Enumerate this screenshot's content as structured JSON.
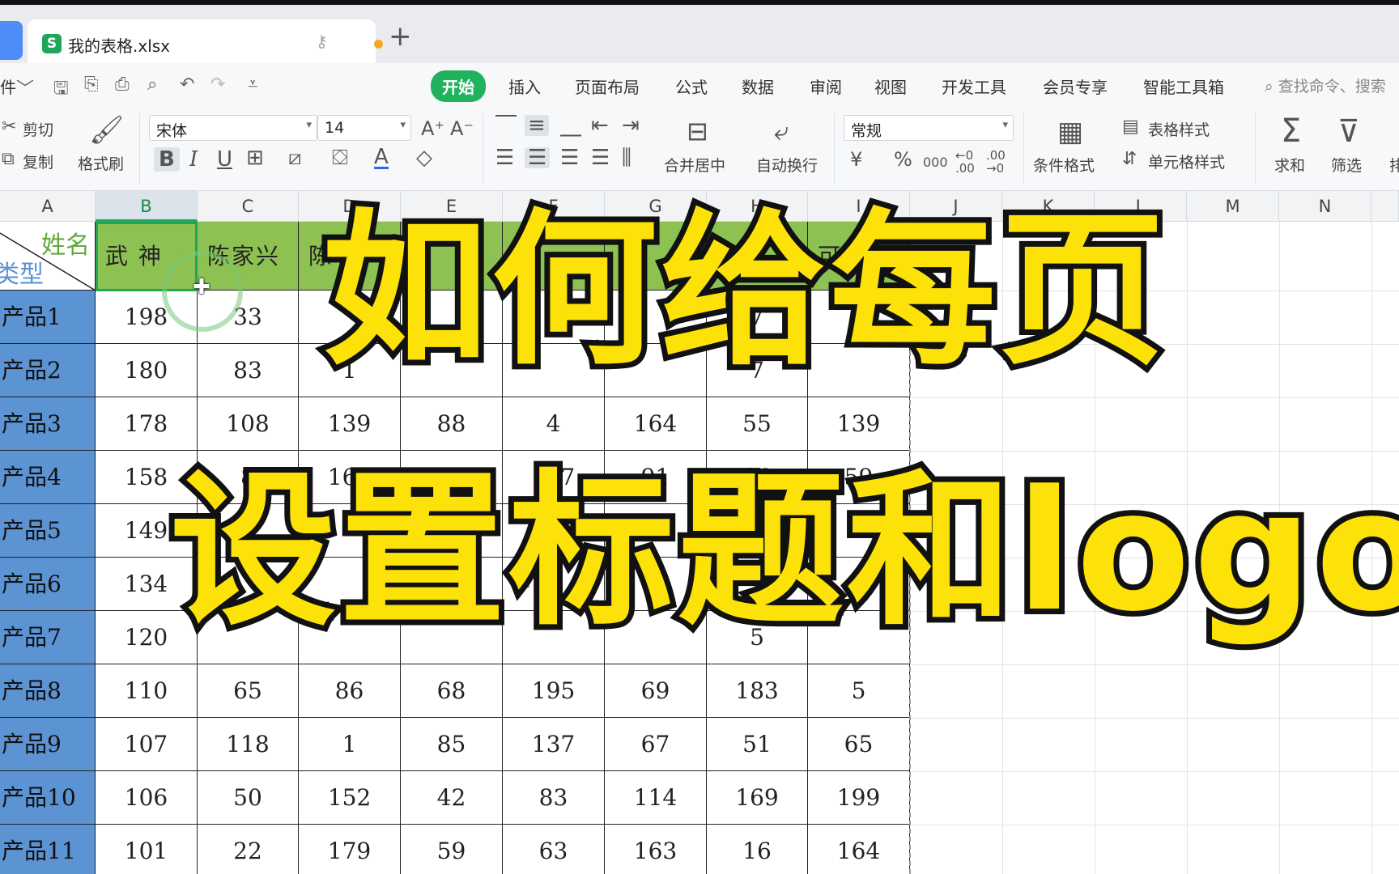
{
  "tab_bar": {
    "doc_icon": "S",
    "doc_title": "我的表格.xlsx",
    "key_icon": "key-icon",
    "unsaved_dot_color": "#f5a623",
    "new_tab_icon": "+"
  },
  "menu": {
    "file_partial": "件",
    "tabs": [
      "开始",
      "插入",
      "页面布局",
      "公式",
      "数据",
      "审阅",
      "视图",
      "开发工具",
      "会员专享",
      "智能工具箱"
    ],
    "active_tab": "开始",
    "search_placeholder": "查找命令、搜索"
  },
  "ribbon": {
    "cut": "剪切",
    "copy": "复制",
    "format_painter": "格式刷",
    "font_name": "宋体",
    "font_size": "14",
    "merge_center": "合并居中",
    "wrap_text": "自动换行",
    "number_format": "常规",
    "conditional_format": "条件格式",
    "table_style": "表格样式",
    "cell_style": "单元格样式",
    "sum": "求和",
    "filter": "筛选",
    "sort_partial": "排"
  },
  "sheet": {
    "columns": [
      "A",
      "B",
      "C",
      "D",
      "E",
      "F",
      "G",
      "H",
      "I",
      "J",
      "K",
      "L",
      "M",
      "N"
    ],
    "selected_column": "B",
    "header_diag_top": "姓名",
    "header_diag_bottom": "类型",
    "visible_headers": [
      "武 神",
      "陈家兴",
      "陈",
      "",
      "",
      "",
      "",
      "可"
    ],
    "rows": [
      {
        "label": "产品1",
        "cells": [
          "198",
          "33",
          "",
          "",
          "",
          "",
          "7",
          ""
        ]
      },
      {
        "label": "产品2",
        "cells": [
          "180",
          "83",
          "1",
          "",
          "",
          "",
          "7",
          ""
        ]
      },
      {
        "label": "产品3",
        "cells": [
          "178",
          "108",
          "139",
          "88",
          "4",
          "164",
          "55",
          "139"
        ]
      },
      {
        "label": "产品4",
        "cells": [
          "158",
          "8",
          "164",
          "109",
          "157",
          "91",
          "46",
          "59"
        ]
      },
      {
        "label": "产品5",
        "cells": [
          "149",
          "",
          "",
          "",
          "",
          "",
          "",
          ""
        ]
      },
      {
        "label": "产品6",
        "cells": [
          "134",
          "",
          "",
          "",
          "",
          "",
          "",
          ""
        ]
      },
      {
        "label": "产品7",
        "cells": [
          "120",
          "",
          "",
          "",
          "",
          "",
          "5",
          ""
        ]
      },
      {
        "label": "产品8",
        "cells": [
          "110",
          "65",
          "86",
          "68",
          "195",
          "69",
          "183",
          "5"
        ]
      },
      {
        "label": "产品9",
        "cells": [
          "107",
          "118",
          "1",
          "85",
          "137",
          "67",
          "51",
          "65"
        ]
      },
      {
        "label": "产品10",
        "cells": [
          "106",
          "50",
          "152",
          "42",
          "83",
          "114",
          "169",
          "199"
        ]
      },
      {
        "label": "产品11",
        "cells": [
          "101",
          "22",
          "179",
          "59",
          "63",
          "163",
          "16",
          "164"
        ]
      }
    ],
    "header_fill": "#8dc152",
    "row_label_fill": "#5b93d3"
  },
  "overlay": {
    "line1": "如何给每页",
    "line2": "设置标题和logo",
    "fill_color": "#fde20a"
  }
}
